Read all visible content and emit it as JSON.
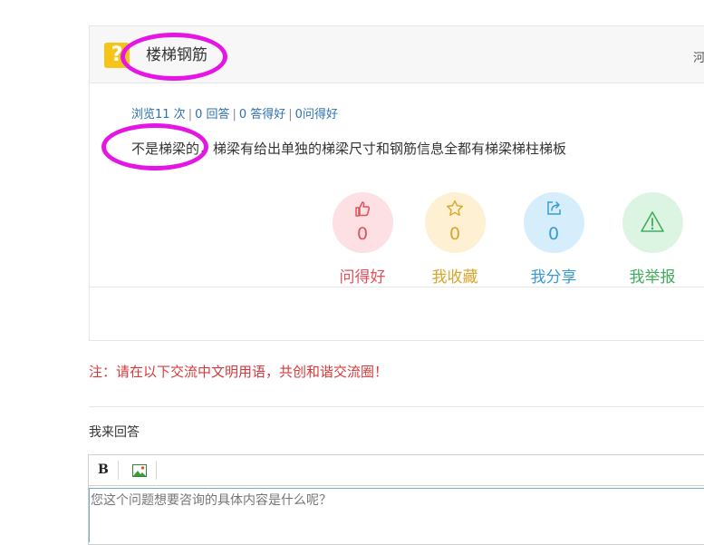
{
  "question": {
    "icon": "question-mark-icon",
    "icon_glyph": "?",
    "title": "楼梯钢筋",
    "header_right": "河",
    "stats": {
      "views": "浏览11 次",
      "answers": "0 回答",
      "good_answers": "0 答得好",
      "good_questions": "0问得好"
    },
    "body": "不是梯梁的，梯梁有给出单独的梯梁尺寸和钢筋信息全都有梯梁梯柱梯板"
  },
  "actions": [
    {
      "label": "问得好",
      "count": "0",
      "icon": "thumbs-up-icon",
      "color": "#e0525a",
      "bg": "#fde0e3"
    },
    {
      "label": "我收藏",
      "count": "0",
      "icon": "star-icon",
      "color": "#d9a62a",
      "bg": "#fdf0d3"
    },
    {
      "label": "我分享",
      "count": "0",
      "icon": "share-icon",
      "color": "#3a9bd4",
      "bg": "#d6eefb"
    },
    {
      "label": "我举报",
      "count": "",
      "icon": "warning-icon",
      "color": "#3fae5c",
      "bg": "#dcf5e2"
    }
  ],
  "notice": "注：请在以下交流中文明用语，共创和谐交流圈！",
  "answer": {
    "label": "我来回答",
    "toolbar": {
      "bold_label": "B",
      "bold_icon": "bold-icon",
      "image_icon": "image-icon"
    },
    "placeholder": "您这个问题想要咨询的具体内容是什么呢？"
  },
  "colors": {
    "accent_link": "#2d6fb3",
    "notice_red": "#d9393a",
    "annotation_magenta": "#e515e6",
    "question_icon_yellow": "#f4c518"
  }
}
